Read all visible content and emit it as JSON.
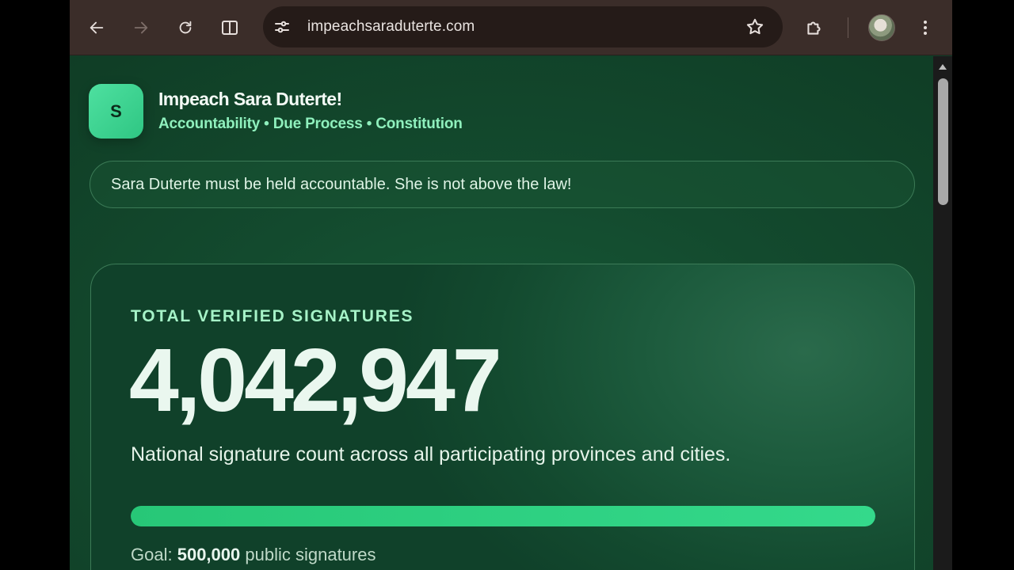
{
  "browser": {
    "url": "impeachsaraduterte.com"
  },
  "site": {
    "logo_letter": "S",
    "title": "Impeach Sara Duterte!",
    "tagline": "Accountability • Due Process • Constitution",
    "notice": "Sara Duterte must be held accountable. She is not above the law!"
  },
  "signatures": {
    "label": "TOTAL VERIFIED SIGNATURES",
    "count": "4,042,947",
    "description": "National signature count across all participating provinces and cities.",
    "progress_percent": 100,
    "goal_prefix": "Goal:",
    "goal_value": "500,000",
    "goal_suffix": "public signatures"
  },
  "colors": {
    "accent": "#34d98b",
    "page_bg": "#134a2e",
    "toolbar_bg": "#3b2d29"
  }
}
